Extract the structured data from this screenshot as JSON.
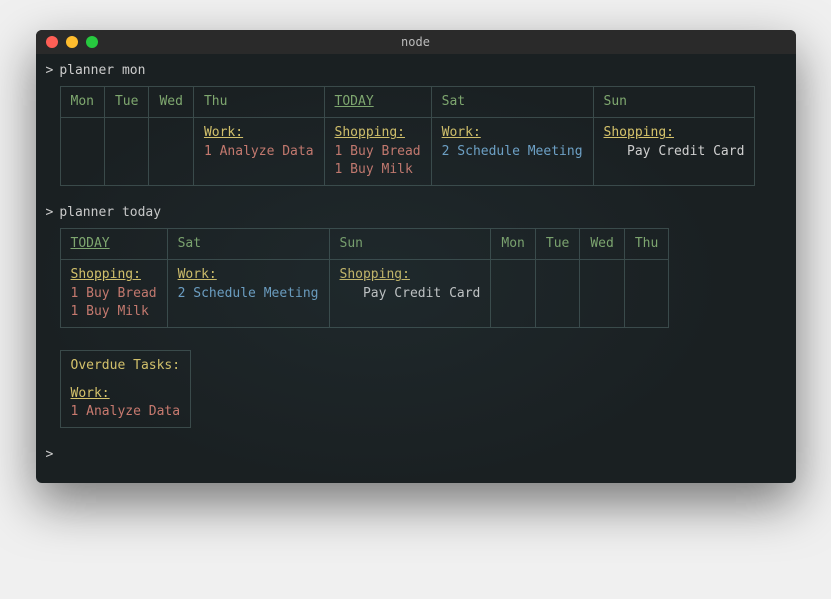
{
  "window": {
    "title": "node"
  },
  "prompt": ">",
  "commands": {
    "cmd1": "planner mon",
    "cmd2": "planner today"
  },
  "table1": {
    "headers": [
      "Mon",
      "Tue",
      "Wed",
      "Thu",
      "TODAY",
      "Sat",
      "Sun"
    ],
    "todayIndex": 4,
    "cols": [
      {
        "content": null
      },
      {
        "content": null
      },
      {
        "content": null
      },
      {
        "category": "Work:",
        "catClass": "cat-work",
        "tasks": [
          {
            "pri": "1",
            "text": "Analyze Data",
            "cls": "task-red"
          }
        ]
      },
      {
        "category": "Shopping:",
        "catClass": "cat-shop",
        "tasks": [
          {
            "pri": "1",
            "text": "Buy Bread",
            "cls": "task-red"
          },
          {
            "pri": "1",
            "text": "Buy Milk",
            "cls": "task-red"
          }
        ]
      },
      {
        "category": "Work:",
        "catClass": "cat-work",
        "tasks": [
          {
            "pri": "2",
            "text": "Schedule Meeting",
            "cls": "task-blue"
          }
        ]
      },
      {
        "category": "Shopping:",
        "catClass": "cat-shop",
        "tasks": [
          {
            "pri": " ",
            "text": " Pay Credit Card",
            "cls": "task-plain"
          }
        ]
      }
    ]
  },
  "table2": {
    "headers": [
      "TODAY",
      "Sat",
      "Sun",
      "Mon",
      "Tue",
      "Wed",
      "Thu"
    ],
    "todayIndex": 0,
    "cols": [
      {
        "category": "Shopping:",
        "catClass": "cat-shop",
        "tasks": [
          {
            "pri": "1",
            "text": "Buy Bread",
            "cls": "task-red"
          },
          {
            "pri": "1",
            "text": "Buy Milk",
            "cls": "task-red"
          }
        ]
      },
      {
        "category": "Work:",
        "catClass": "cat-work",
        "tasks": [
          {
            "pri": "2",
            "text": "Schedule Meeting",
            "cls": "task-blue"
          }
        ]
      },
      {
        "category": "Shopping:",
        "catClass": "cat-shop",
        "tasks": [
          {
            "pri": " ",
            "text": " Pay Credit Card",
            "cls": "task-plain"
          }
        ]
      },
      {
        "content": null
      },
      {
        "content": null
      },
      {
        "content": null
      },
      {
        "content": null
      }
    ]
  },
  "overdue": {
    "title": "Overdue Tasks:",
    "category": "Work:",
    "tasks": [
      {
        "pri": "1",
        "text": "Analyze Data",
        "cls": "task-red"
      }
    ]
  }
}
